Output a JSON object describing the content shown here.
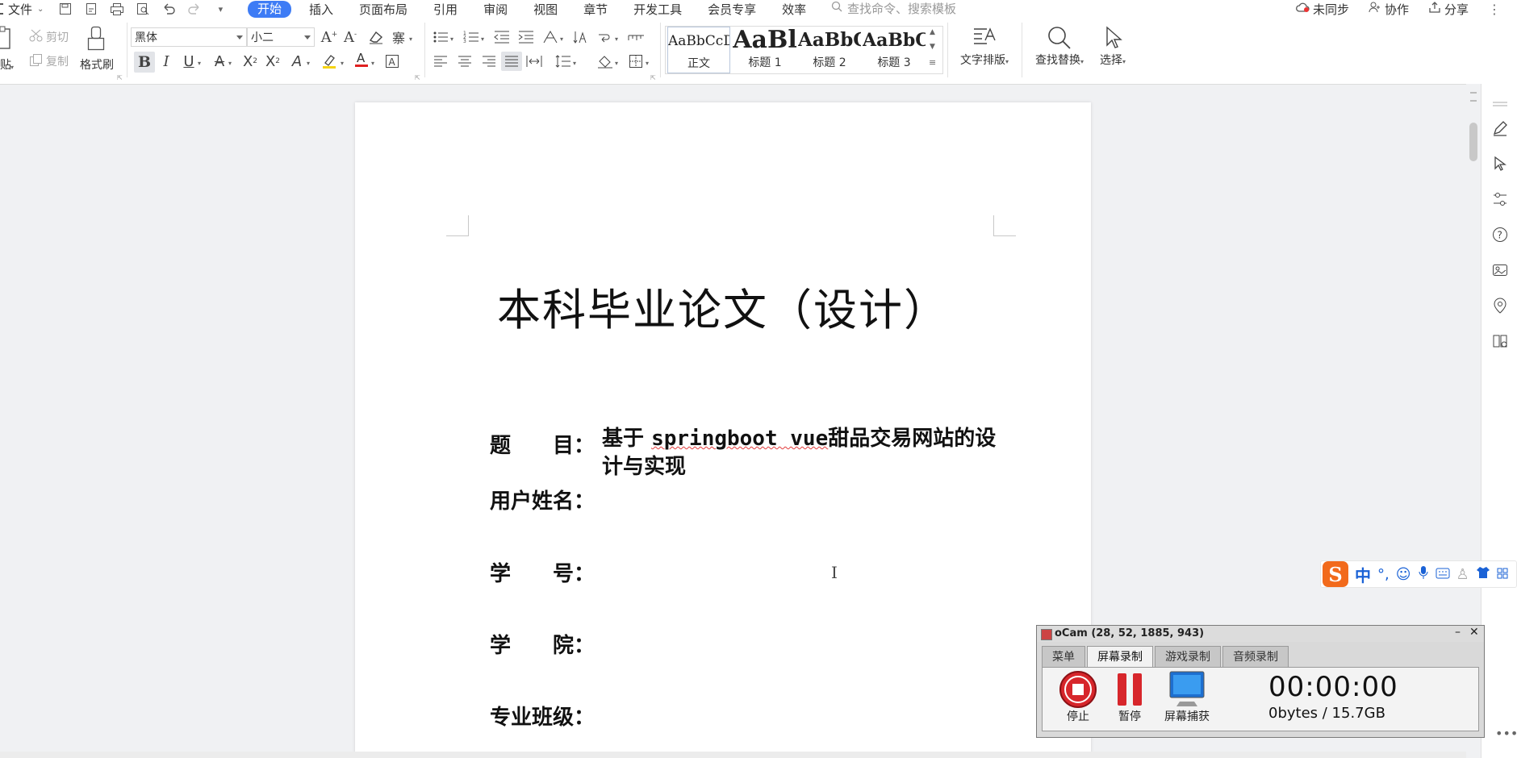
{
  "menubar": {
    "file_label": "文件",
    "tabs": [
      "开始",
      "插入",
      "页面布局",
      "引用",
      "审阅",
      "视图",
      "章节",
      "开发工具",
      "会员专享",
      "效率"
    ],
    "search_placeholder": "查找命令、搜索模板",
    "unsynced": "未同步",
    "collab": "协作",
    "share": "分享"
  },
  "ribbon": {
    "paste": "贴",
    "cut": "剪切",
    "copy": "复制",
    "format_painter": "格式刷",
    "font_name": "黑体",
    "font_size": "小二",
    "styles": [
      {
        "sample": "AaBbCcDd",
        "name": "正文"
      },
      {
        "sample": "AaBl",
        "name": "标题 1"
      },
      {
        "sample": "AaBbC",
        "name": "标题 2"
      },
      {
        "sample": "AaBbC",
        "name": "标题 3"
      }
    ],
    "text_layout": "文字排版",
    "find_replace": "查找替换",
    "select": "选择"
  },
  "document": {
    "title": "本科毕业论文（设计）",
    "topic_key": "题　　目：",
    "topic_value_a": "基于",
    "topic_value_b": "springboot vue",
    "topic_value_c": "甜品交易网站的设计与实现",
    "username_key": "用户姓名：",
    "student_id_key": "学　　号：",
    "college_key": "学　　院：",
    "class_key": "专业班级："
  },
  "ime": {
    "mode": "中",
    "punct": "°,"
  },
  "ocam": {
    "title": "oCam (28, 52, 1885, 943)",
    "tabs": [
      "菜单",
      "屏幕录制",
      "游戏录制",
      "音频录制"
    ],
    "active_tab": "屏幕录制",
    "stop": "停止",
    "pause": "暂停",
    "capture": "屏幕捕获",
    "timer": "00:00:00",
    "size": "0bytes / 15.7GB"
  },
  "colors": {
    "accent": "#3e7cf5",
    "ime_orange": "#f26a1b",
    "ocam_stop": "#d7262b"
  }
}
